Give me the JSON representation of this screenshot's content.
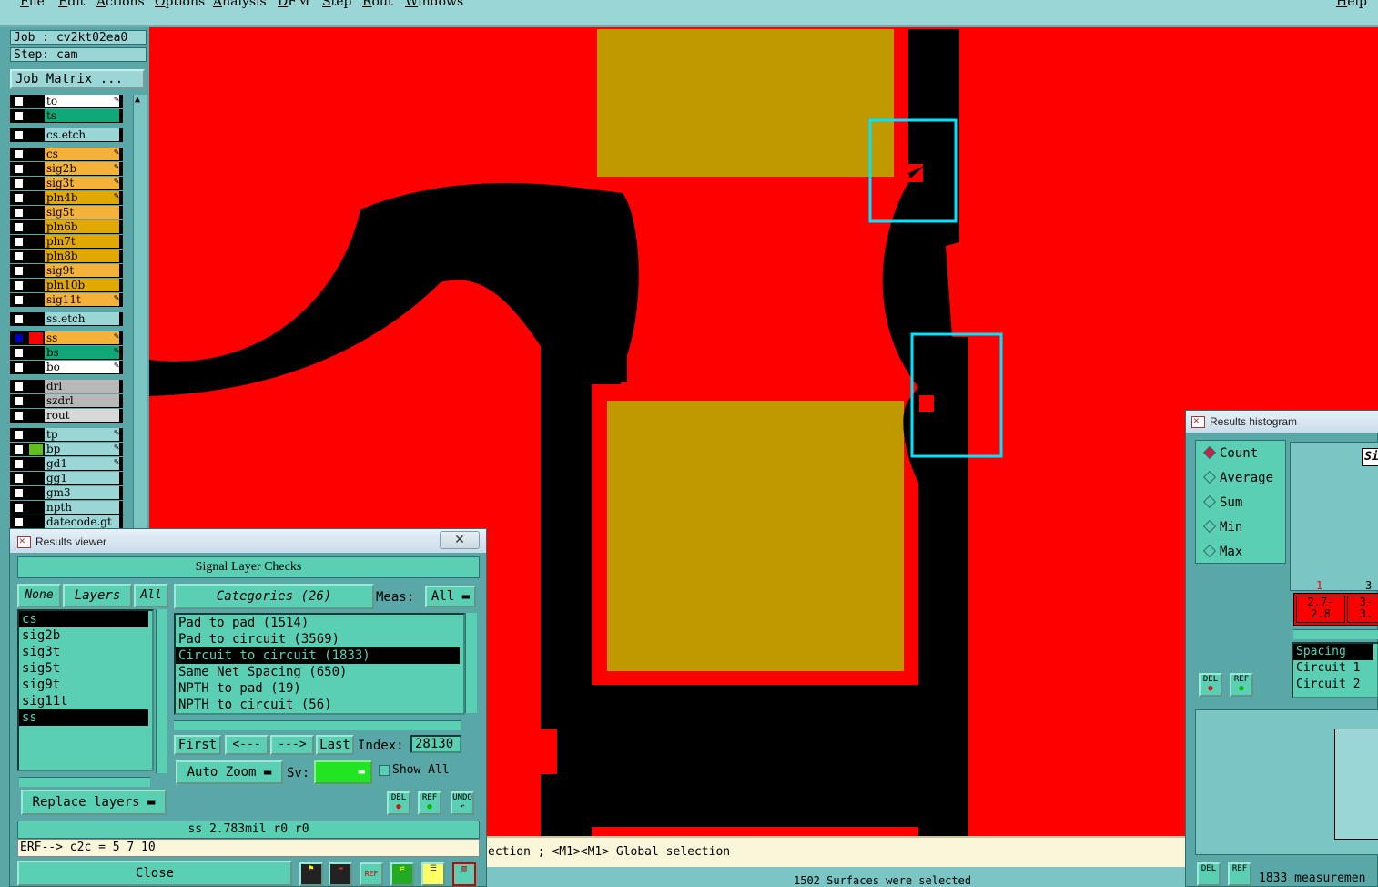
{
  "menu": [
    "File",
    "Edit",
    "Actions",
    "Options",
    "Analysis",
    "DFM",
    "Step",
    "Rout",
    "Windows"
  ],
  "help": "Help",
  "job": {
    "job_line": "Job : cv2kt02ea0",
    "step_line": "Step: cam",
    "matrix_button": "Job Matrix ..."
  },
  "layers": [
    {
      "name": "to",
      "color": "#ffffff",
      "edit": true
    },
    {
      "name": "ts",
      "color": "#10a878",
      "edit": false
    },
    {
      "name": "cs.etch",
      "color": "#9bd6d6",
      "edit": false
    },
    {
      "name": "cs",
      "color": "#f5b23a",
      "edit": true
    },
    {
      "name": "sig2b",
      "color": "#f5b23a",
      "edit": true
    },
    {
      "name": "sig3t",
      "color": "#f5b23a",
      "edit": true
    },
    {
      "name": "pln4b",
      "color": "#e0a800",
      "edit": true
    },
    {
      "name": "sig5t",
      "color": "#f5b23a",
      "edit": false
    },
    {
      "name": "pln6b",
      "color": "#e0a800",
      "edit": false
    },
    {
      "name": "pln7t",
      "color": "#e0a800",
      "edit": false
    },
    {
      "name": "pln8b",
      "color": "#e0a800",
      "edit": false
    },
    {
      "name": "sig9t",
      "color": "#f5b23a",
      "edit": false
    },
    {
      "name": "pln10b",
      "color": "#e0a800",
      "edit": false
    },
    {
      "name": "sig11t",
      "color": "#f5b23a",
      "edit": true
    },
    {
      "name": "ss.etch",
      "color": "#9bd6d6",
      "edit": false
    },
    {
      "name": "ss",
      "color": "#f5b23a",
      "edit": true
    },
    {
      "name": "bs",
      "color": "#10a878",
      "edit": true
    },
    {
      "name": "bo",
      "color": "#ffffff",
      "edit": true
    },
    {
      "name": "drl",
      "color": "#b8b8b8",
      "edit": false
    },
    {
      "name": "szdrl",
      "color": "#b8b8b8",
      "edit": false
    },
    {
      "name": "rout",
      "color": "#d8d8d8",
      "edit": false
    },
    {
      "name": "tp",
      "color": "#9bd6d6",
      "edit": true
    },
    {
      "name": "bp",
      "color": "#9bd6d6",
      "edit": true
    },
    {
      "name": "gd1",
      "color": "#9bd6d6",
      "edit": true
    },
    {
      "name": "gg1",
      "color": "#9bd6d6",
      "edit": false
    },
    {
      "name": "gm3",
      "color": "#9bd6d6",
      "edit": false
    },
    {
      "name": "npth",
      "color": "#9bd6d6",
      "edit": false
    },
    {
      "name": "datecode.gt",
      "color": "#9bd6d6",
      "edit": false
    }
  ],
  "status": {
    "hint": "ection ; <M1><M1> Global selection",
    "selected": "1502 Surfaces were selected"
  },
  "results_viewer": {
    "title": "Results viewer",
    "close_x": "✕",
    "header": "Signal Layer Checks",
    "none_btn": "None",
    "layers_btn": "Layers",
    "all_btn": "All",
    "categories_btn": "Categories (26)",
    "meas_label": "Meas:",
    "meas_value": "All",
    "layer_list": [
      "cs",
      "sig2b",
      "sig3t",
      "sig5t",
      "sig9t",
      "sig11t",
      "ss"
    ],
    "category_list": [
      "Pad to pad (1514)",
      "Pad to circuit (3569)",
      "Circuit to circuit (1833)",
      "Same Net Spacing (650)",
      "NPTH to pad (19)",
      "NPTH to circuit (56)"
    ],
    "first_btn": "First",
    "prev_btn": "<---",
    "next_btn": "--->",
    "last_btn": "Last",
    "index_label": "Index:",
    "index_value": "28130",
    "autozoom": "Auto Zoom",
    "sv_label": "Sv:",
    "show_all": "Show All",
    "replace_layers": "Replace layers",
    "del": "DEL",
    "ref": "REF",
    "undo": "UNDO",
    "measure_line": "ss 2.783mil  r0  r0",
    "erf_line": "ERF--> c2c = 5 7 10",
    "close_btn": "Close",
    "tb_ref": "REF"
  },
  "histogram": {
    "title": "Results histogram",
    "options": [
      "Count",
      "Average",
      "Sum",
      "Min",
      "Max"
    ],
    "selected": "Count",
    "ruler_1": "1",
    "ruler_3": "3",
    "bin1": "2.7-\n2.8",
    "bin2": "3-\n3.",
    "type_list": [
      "Spacing",
      "Circuit 1",
      "Circuit 2"
    ],
    "corner_label": "Si",
    "del": "DEL",
    "ref": "REF",
    "measurements": "1833 measuremen"
  },
  "colors": {
    "board": "#ff0000",
    "copper": "#000000",
    "pad": "#c09800",
    "marker": "#00e5ff",
    "teal": "#5bcfb3"
  }
}
